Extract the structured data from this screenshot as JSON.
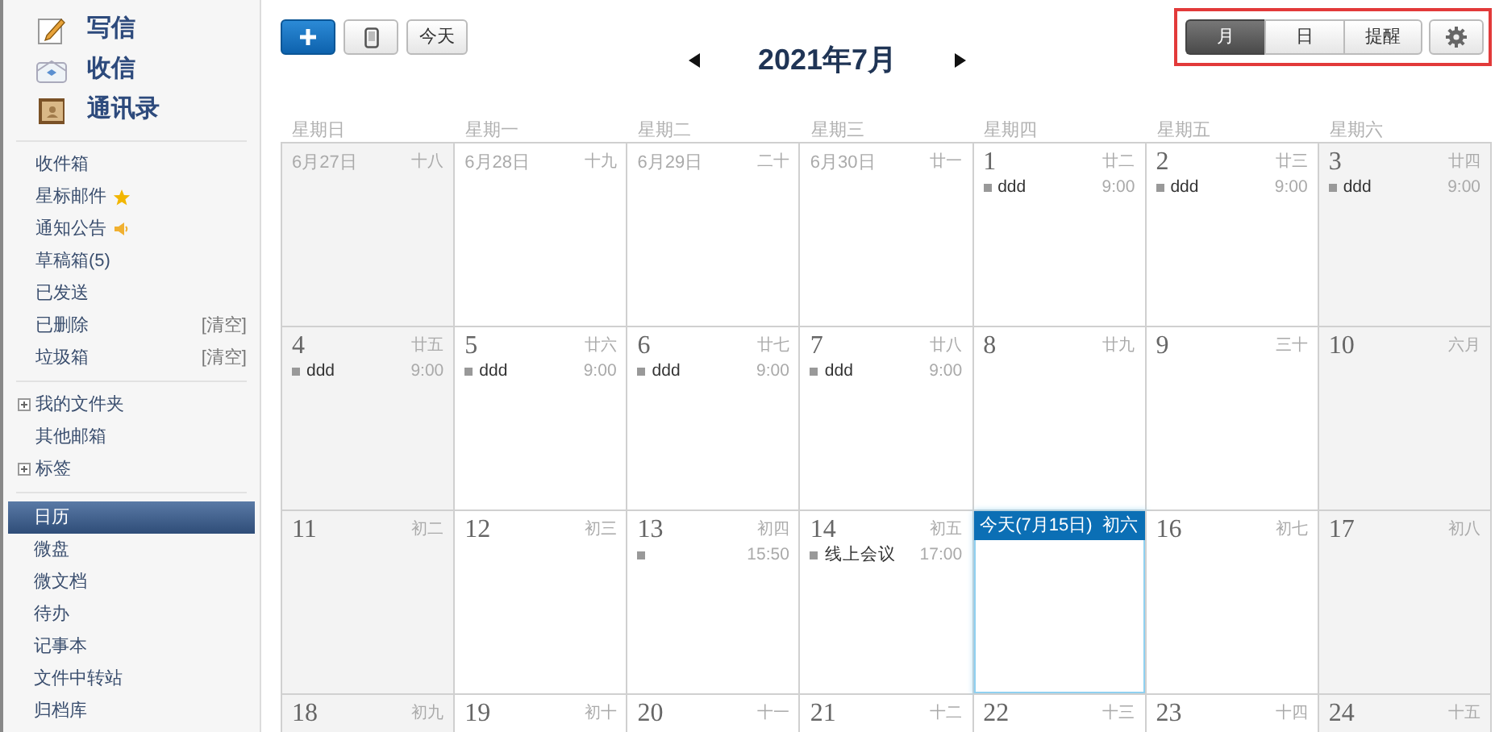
{
  "sidebar": {
    "top_actions": [
      {
        "label": "写信"
      },
      {
        "label": "收信"
      },
      {
        "label": "通讯录"
      }
    ],
    "folders": [
      {
        "label": "收件箱"
      },
      {
        "label": "星标邮件",
        "kind": "starred"
      },
      {
        "label": "通知公告",
        "kind": "notice"
      },
      {
        "label": "草稿箱(5)"
      },
      {
        "label": "已发送"
      },
      {
        "label": "已删除",
        "action": "[清空]"
      },
      {
        "label": "垃圾箱",
        "action": "[清空]"
      }
    ],
    "groups": [
      {
        "label": "我的文件夹",
        "expandable": true
      },
      {
        "label": "其他邮箱",
        "expandable": false
      },
      {
        "label": "标签",
        "expandable": true
      }
    ],
    "apps": [
      {
        "label": "日历",
        "selected": true
      },
      {
        "label": "微盘",
        "selected": false
      },
      {
        "label": "微文档",
        "selected": false
      },
      {
        "label": "待办",
        "selected": false
      },
      {
        "label": "记事本",
        "selected": false
      },
      {
        "label": "文件中转站",
        "selected": false
      },
      {
        "label": "归档库",
        "selected": false
      }
    ]
  },
  "toolbar": {
    "today_button": "今天",
    "title": "2021年7月",
    "views": [
      {
        "label": "月",
        "selected": true
      },
      {
        "label": "日",
        "selected": false
      },
      {
        "label": "提醒",
        "selected": false
      }
    ]
  },
  "weekdays": [
    "星期日",
    "星期一",
    "星期二",
    "星期三",
    "星期四",
    "星期五",
    "星期六"
  ],
  "weeks": [
    [
      {
        "date": "6月27日",
        "lunar": "十八",
        "other_month": true
      },
      {
        "date": "6月28日",
        "lunar": "十九",
        "other_month": true
      },
      {
        "date": "6月29日",
        "lunar": "二十",
        "other_month": true
      },
      {
        "date": "6月30日",
        "lunar": "廿一",
        "other_month": true
      },
      {
        "date": "1",
        "lunar": "廿二",
        "events": [
          {
            "title": "ddd",
            "time": "9:00"
          }
        ]
      },
      {
        "date": "2",
        "lunar": "廿三",
        "events": [
          {
            "title": "ddd",
            "time": "9:00"
          }
        ]
      },
      {
        "date": "3",
        "lunar": "廿四",
        "events": [
          {
            "title": "ddd",
            "time": "9:00"
          }
        ]
      }
    ],
    [
      {
        "date": "4",
        "lunar": "廿五",
        "events": [
          {
            "title": "ddd",
            "time": "9:00"
          }
        ]
      },
      {
        "date": "5",
        "lunar": "廿六",
        "events": [
          {
            "title": "ddd",
            "time": "9:00"
          }
        ]
      },
      {
        "date": "6",
        "lunar": "廿七",
        "events": [
          {
            "title": "ddd",
            "time": "9:00"
          }
        ]
      },
      {
        "date": "7",
        "lunar": "廿八",
        "events": [
          {
            "title": "ddd",
            "time": "9:00"
          }
        ]
      },
      {
        "date": "8",
        "lunar": "廿九"
      },
      {
        "date": "9",
        "lunar": "三十"
      },
      {
        "date": "10",
        "lunar": "六月"
      }
    ],
    [
      {
        "date": "11",
        "lunar": "初二"
      },
      {
        "date": "12",
        "lunar": "初三"
      },
      {
        "date": "13",
        "lunar": "初四",
        "events": [
          {
            "time": "15:50"
          }
        ]
      },
      {
        "date": "14",
        "lunar": "初五",
        "events": [
          {
            "title": "线上会议",
            "time": "17:00"
          }
        ]
      },
      {
        "date": "今天(7月15日)",
        "lunar": "初六",
        "today": true
      },
      {
        "date": "16",
        "lunar": "初七"
      },
      {
        "date": "17",
        "lunar": "初八"
      }
    ],
    [
      {
        "date": "18",
        "lunar": "初九"
      },
      {
        "date": "19",
        "lunar": "初十"
      },
      {
        "date": "20",
        "lunar": "十一"
      },
      {
        "date": "21",
        "lunar": "十二"
      },
      {
        "date": "22",
        "lunar": "十三"
      },
      {
        "date": "23",
        "lunar": "十四"
      },
      {
        "date": "24",
        "lunar": "十五"
      }
    ]
  ]
}
